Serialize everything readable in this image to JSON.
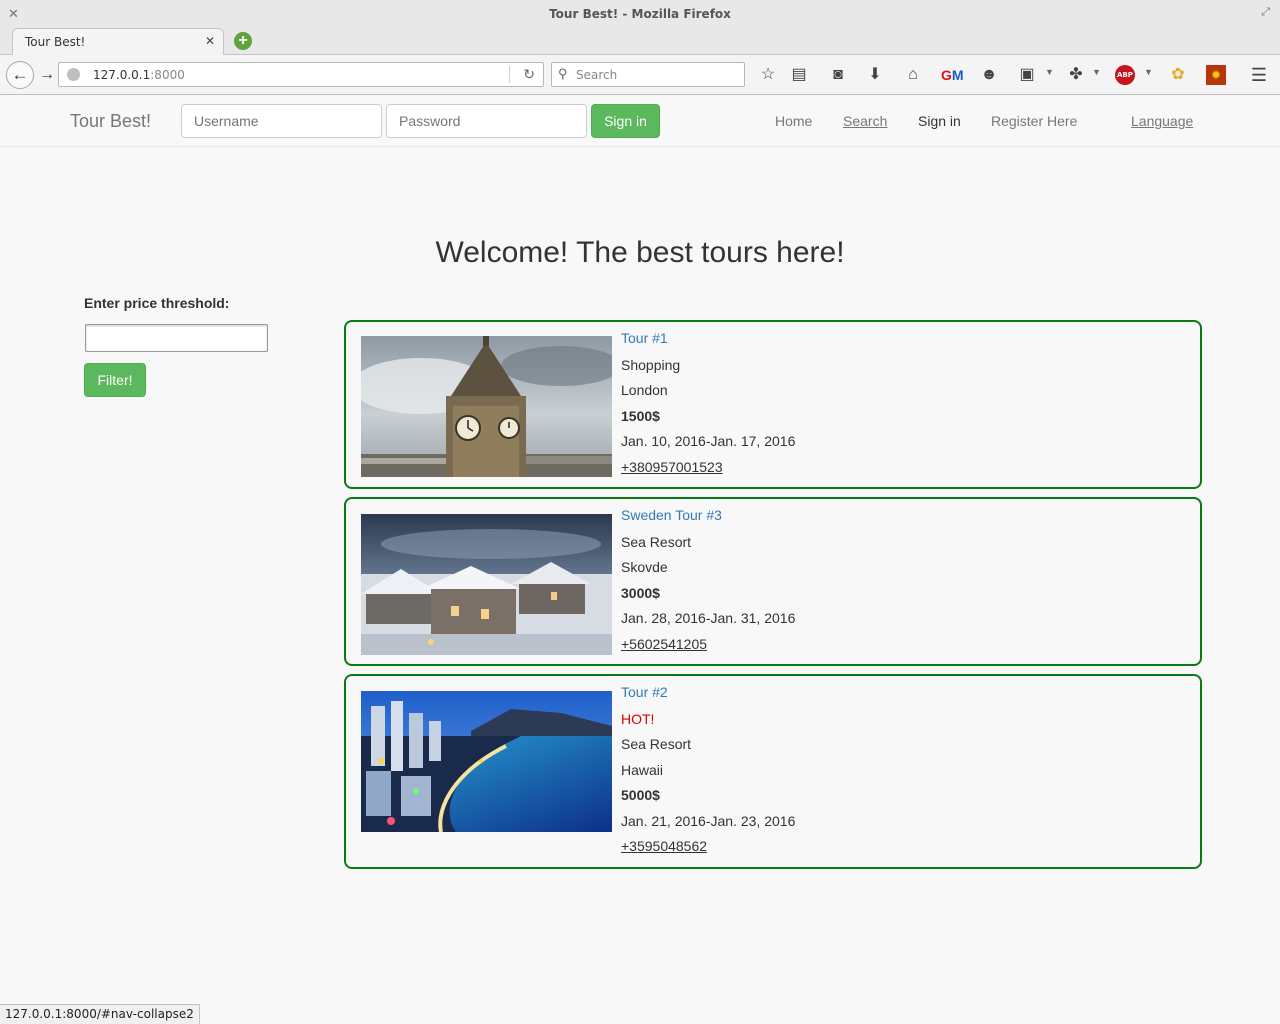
{
  "browser": {
    "window_title": "Tour Best! - Mozilla Firefox",
    "tab_title": "Tour Best!",
    "url_host": "127.0.0.1",
    "url_port": ":8000",
    "search_placeholder": "Search",
    "status_url": "127.0.0.1:8000/#nav-collapse2",
    "abp_label": "ABP"
  },
  "site_nav": {
    "brand": "Tour Best!",
    "username_placeholder": "Username",
    "password_placeholder": "Password",
    "signin_button": "Sign in",
    "links": {
      "home": "Home",
      "search": "Search",
      "signin": "Sign in",
      "register": "Register Here",
      "language": "Language"
    }
  },
  "main": {
    "headline": "Welcome! The best tours here!",
    "filter_label": "Enter price threshold:",
    "filter_value": "",
    "filter_button": "Filter!"
  },
  "tours": [
    {
      "title": "Tour #1",
      "hot": "",
      "category": "Shopping",
      "location": "London",
      "price": "1500$",
      "dates": "Jan. 10, 2016-Jan. 17, 2016",
      "phone": "+380957001523",
      "image": "big-ben-photo"
    },
    {
      "title": "Sweden Tour #3",
      "hot": "",
      "category": "Sea Resort",
      "location": "Skovde",
      "price": "3000$",
      "dates": "Jan. 28, 2016-Jan. 31, 2016",
      "phone": "+5602541205",
      "image": "snowy-town-photo"
    },
    {
      "title": "Tour #2",
      "hot": "HOT!",
      "category": "Sea Resort",
      "location": "Hawaii",
      "price": "5000$",
      "dates": "Jan. 21, 2016-Jan. 23, 2016",
      "phone": "+3595048562",
      "image": "hawaii-coast-photo"
    }
  ],
  "colors": {
    "accent_green": "#5cb85c",
    "card_border": "#0a7a15",
    "link_blue": "#337ab7",
    "hot_red": "#d9000b"
  }
}
